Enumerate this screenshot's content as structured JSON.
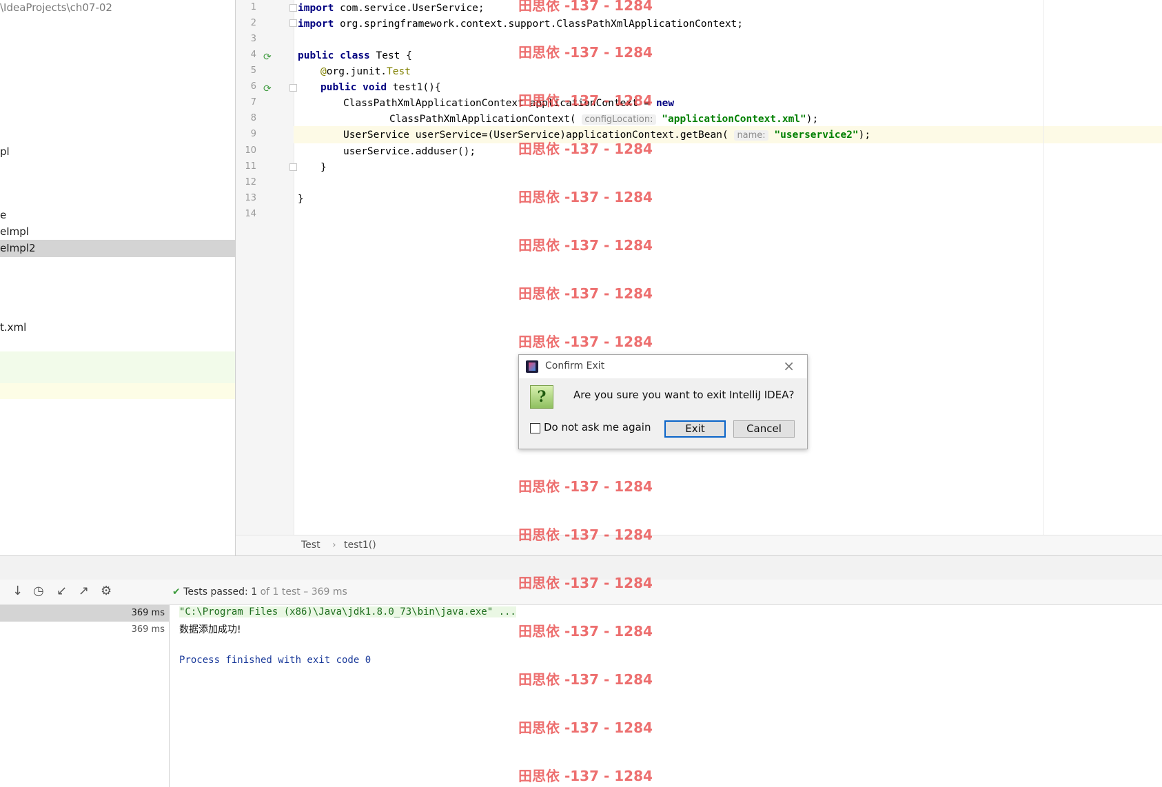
{
  "project": {
    "path": "\\IdeaProjects\\ch07-02",
    "items": [
      {
        "label": "pl"
      },
      {
        "label": "e"
      },
      {
        "label": "eImpl"
      },
      {
        "label": "eImpl2"
      },
      {
        "label": "t.xml"
      }
    ]
  },
  "editor": {
    "line_numbers": [
      "1",
      "2",
      "3",
      "4",
      "5",
      "6",
      "7",
      "8",
      "9",
      "10",
      "11",
      "12",
      "13",
      "14"
    ],
    "code": {
      "l1_kw": "import",
      "l1_rest": " com.service.UserService;",
      "l2_kw": "import",
      "l2_rest": " org.springframework.context.support.ClassPathXmlApplicationContext;",
      "l4_kw1": "public",
      "l4_kw2": "class",
      "l4_rest": " Test {",
      "l5_ann": "@",
      "l5_mid": "org.junit.",
      "l5_type": "Test",
      "l6_kw1": "public",
      "l6_kw2": "void",
      "l6_rest": " test1(){",
      "l7_text": "ClassPathXmlApplicationContext applicationContext = ",
      "l7_kw": "new",
      "l8_text": "ClassPathXmlApplicationContext( ",
      "l8_hint": "configLocation:",
      "l8_str": "\"applicationContext.xml\"",
      "l8_end": ");",
      "l9_text": "UserService userService=(UserService)applicationContext.getBean( ",
      "l9_hint": "name:",
      "l9_str": "\"userservice2\"",
      "l9_end": ");",
      "l10_text": "userService.adduser();",
      "l11_text": "}",
      "l13_text": "}"
    }
  },
  "breadcrumb": {
    "class": "Test",
    "separator": "›",
    "method": "test1()"
  },
  "test_runner": {
    "status_label": "Tests passed:",
    "status_count": "1",
    "status_rest": "of 1 test – 369 ms",
    "rows": [
      "369 ms",
      "369 ms"
    ]
  },
  "console": {
    "cmd": "\"C:\\Program Files (x86)\\Java\\jdk1.8.0_73\\bin\\java.exe\" ...",
    "output": "数据添加成功!",
    "exit": "Process finished with exit code 0"
  },
  "dialog": {
    "title": "Confirm Exit",
    "message": "Are you sure you want to exit IntelliJ IDEA?",
    "checkbox_label": "Do not ask me again",
    "checkbox_checked": false,
    "exit_label": "Exit",
    "cancel_label": "Cancel",
    "question_glyph": "?"
  },
  "watermark": "田思依 -137 - 1284",
  "colors": {
    "keyword": "#000080",
    "string": "#008000",
    "annotation": "#808000",
    "current_line": "#fdfae6",
    "pass_green": "#3c9a3c",
    "watermark": "#e84646",
    "dialog_default_border": "#0a64c8"
  }
}
